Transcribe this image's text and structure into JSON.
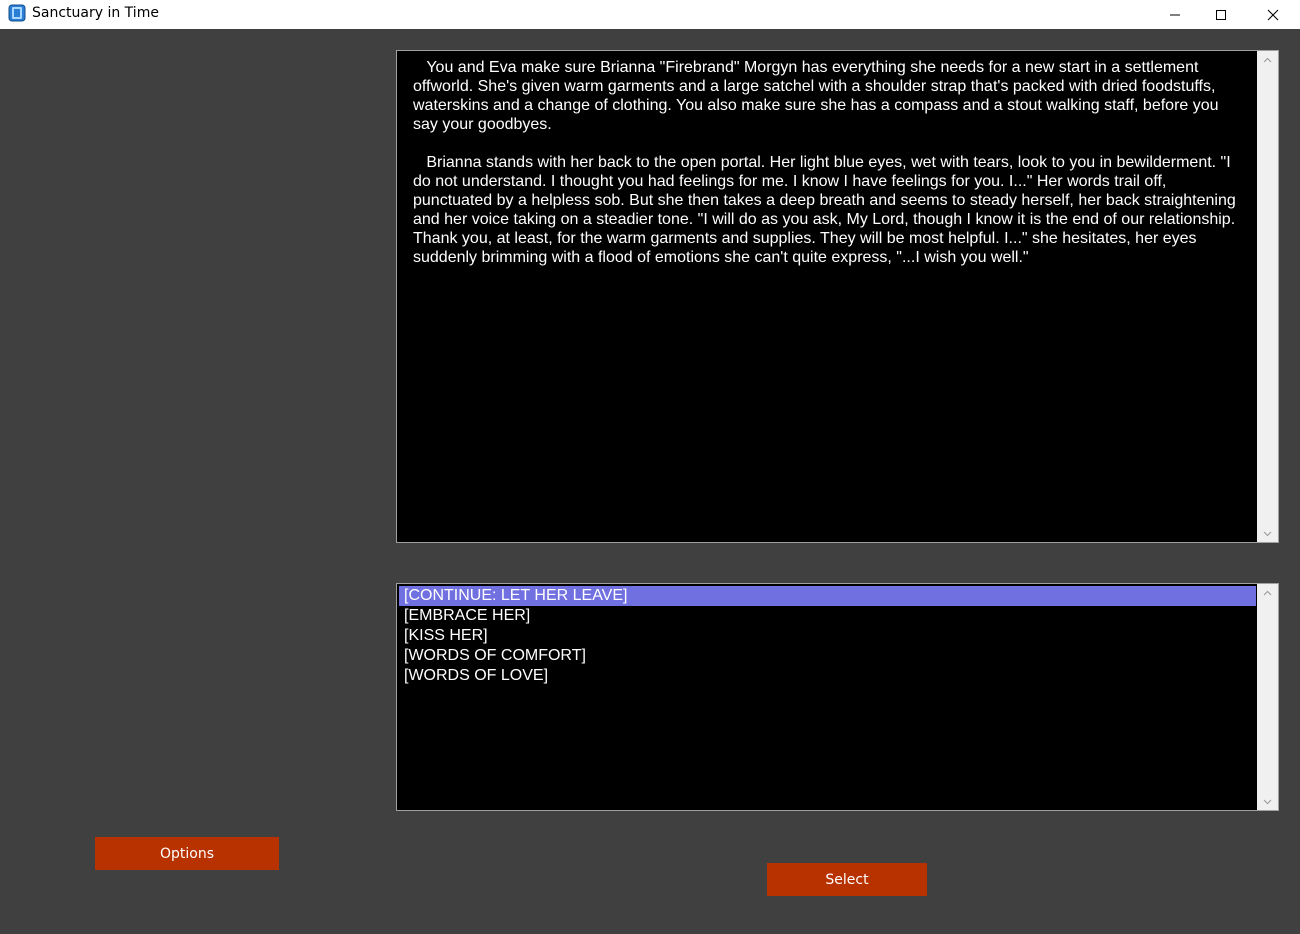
{
  "window": {
    "title": "Sanctuary in Time",
    "icon": "app-icon",
    "controls": [
      "minimize-icon",
      "maximize-icon",
      "close-icon"
    ]
  },
  "story": {
    "paragraphs": [
      "   You and Eva make sure Brianna \"Firebrand\" Morgyn has everything she needs for a new start in a settlement offworld. She's given warm garments and a large satchel with a shoulder strap that's packed with dried foodstuffs, waterskins and a change of clothing. You also make sure she has a compass and a stout walking staff, before you say your goodbyes.",
      "   Brianna stands with her back to the open portal. Her light blue eyes, wet with tears, look to you in bewilderment. \"I do not understand. I thought you had feelings for me. I know I have feelings for you. I...\" Her words trail off, punctuated by a helpless sob. But she then takes a deep breath and seems to steady herself, her back straightening and her voice taking on a steadier tone. \"I will do as you ask, My Lord, though I know it is the end of our relationship. Thank you, at least, for the warm garments and supplies. They will be most helpful. I...\" she hesitates, her eyes suddenly brimming with a flood of emotions she can't quite express, \"...I wish you well.\""
    ]
  },
  "choices": {
    "items": [
      "[CONTINUE: LET HER LEAVE]",
      "[EMBRACE HER]",
      "[KISS HER]",
      "[WORDS OF COMFORT]",
      "[WORDS OF LOVE]"
    ],
    "selected_index": 0
  },
  "buttons": {
    "options_label": "Options",
    "select_label": "Select"
  },
  "colors": {
    "background": "#404040",
    "button": "#b83200",
    "selection": "#7070e0",
    "text_panel": "#000000"
  }
}
